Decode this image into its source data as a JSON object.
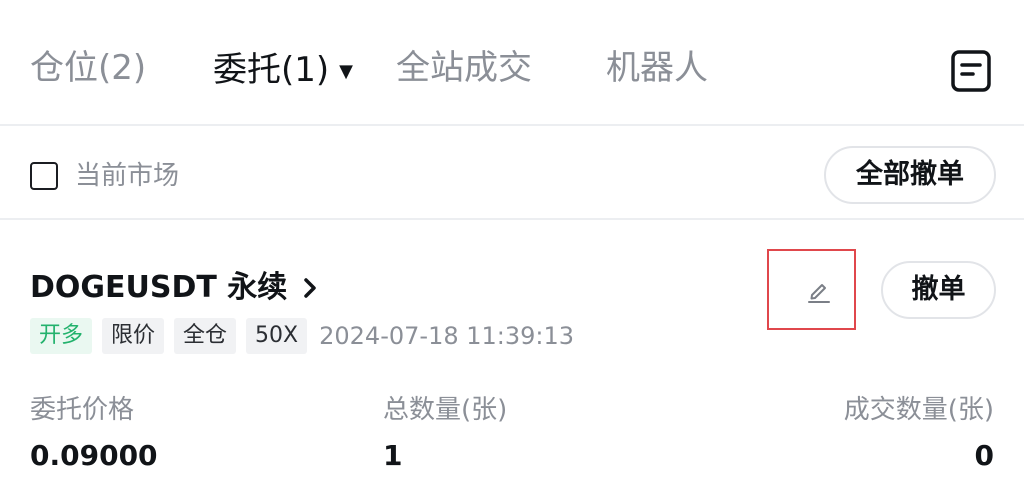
{
  "tabs": {
    "positions": "仓位(2)",
    "orders": "委托(1)",
    "trades": "全站成交",
    "bots": "机器人"
  },
  "filter": {
    "current_market_label": "当前市场",
    "cancel_all_label": "全部撤单"
  },
  "order": {
    "symbol": "DOGEUSDT 永续",
    "tags": {
      "side": "开多",
      "order_type": "限价",
      "margin_mode": "全仓",
      "leverage": "50X"
    },
    "time": "2024-07-18 11:39:13",
    "cancel_label": "撤单",
    "fields": {
      "price_label": "委托价格",
      "price_value": "0.09000",
      "amount_label": "总数量(张)",
      "amount_value": "1",
      "filled_label": "成交数量(张)",
      "filled_value": "0"
    }
  },
  "colors": {
    "accent_green": "#23b26d",
    "highlight_red": "#e0474c",
    "muted_text": "#8b8f97"
  },
  "icons": [
    "caret-down-icon",
    "document-icon",
    "chevron-right-icon",
    "edit-pencil-icon"
  ]
}
